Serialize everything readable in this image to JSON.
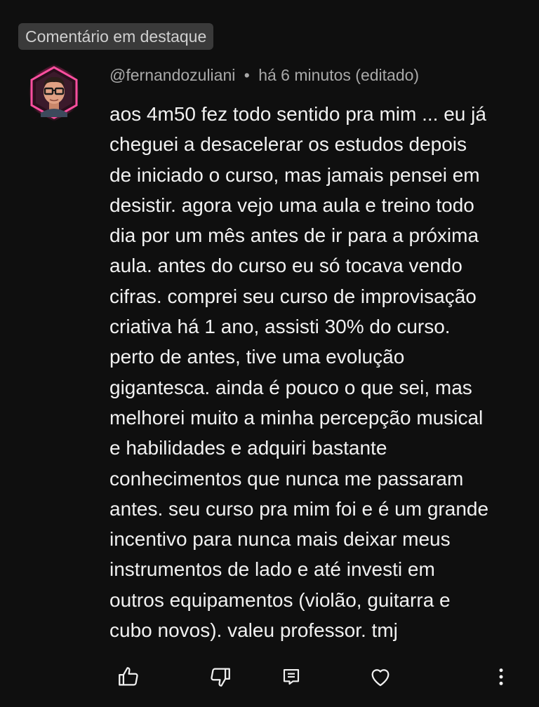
{
  "badge": {
    "label": "Comentário em destaque"
  },
  "comment": {
    "author": "@fernandozuliani",
    "separator": "•",
    "timestamp": "há 6 minutos (editado)",
    "lines": [
      "aos 4m50 fez todo sentido pra mim ... eu já",
      "cheguei a desacelerar os estudos depois",
      "de iniciado o curso, mas jamais pensei em",
      "desistir. agora vejo uma aula e treino todo",
      "dia por um mês antes de ir para a próxima",
      "aula. antes do curso eu só tocava vendo",
      "cifras. comprei seu curso de improvisação",
      "criativa há 1 ano, assisti 30% do curso.",
      "perto de antes, tive uma evolução",
      "gigantesca. ainda é pouco o que sei, mas",
      "melhorei muito a minha percepção musical",
      "e habilidades e adquiri bastante",
      "conhecimentos que nunca me passaram",
      "antes. seu curso pra mim foi e é um grande",
      "incentivo para nunca mais deixar meus",
      "instrumentos de lado e até investi em",
      "outros equipamentos (violão, guitarra e",
      "cubo novos). valeu professor. tmj"
    ]
  },
  "actions": {
    "like_icon": "thumbs-up-icon",
    "dislike_icon": "thumbs-down-icon",
    "reply_icon": "comment-reply-icon",
    "heart_icon": "heart-outline-icon",
    "more_icon": "vertical-ellipsis-icon"
  },
  "colors": {
    "background": "#0f0f0f",
    "badge_background": "#3a3a3a",
    "text_primary": "#f1f1f1",
    "text_secondary": "#a9a9a9",
    "avatar_ring": "#ff2d8a"
  }
}
